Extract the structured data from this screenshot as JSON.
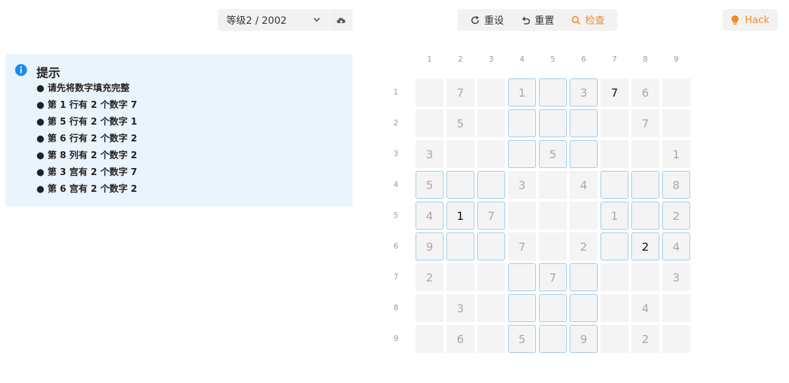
{
  "toolbar": {
    "level_label": "等级2 / 2002",
    "reset_label": "重设",
    "redo_label": "重置",
    "check_label": "检查",
    "hack_label": "Hack"
  },
  "hints": {
    "title": "提示",
    "items": [
      "● 请先将数字填充完整",
      "● 第 1 行有 2 个数字 7",
      "● 第 5 行有 2 个数字 1",
      "● 第 6 行有 2 个数字 2",
      "● 第 8 列有 2 个数字 2",
      "● 第 3 宫有 2 个数字 7",
      "● 第 6 宫有 2 个数字 2"
    ]
  },
  "grid": {
    "col_labels": [
      "1",
      "2",
      "3",
      "4",
      "5",
      "6",
      "7",
      "8",
      "9"
    ],
    "row_labels": [
      "1",
      "2",
      "3",
      "4",
      "5",
      "6",
      "7",
      "8",
      "9"
    ],
    "cells": [
      [
        "",
        "7",
        "",
        "1",
        "",
        "3",
        "7",
        "6",
        ""
      ],
      [
        "",
        "5",
        "",
        "",
        "",
        "",
        "",
        "7",
        ""
      ],
      [
        "3",
        "",
        "",
        "",
        "5",
        "",
        "",
        "",
        "1"
      ],
      [
        "5",
        "",
        "",
        "3",
        "",
        "4",
        "",
        "",
        "8"
      ],
      [
        "4",
        "1",
        "7",
        "",
        "",
        "",
        "1",
        "",
        "2"
      ],
      [
        "9",
        "",
        "",
        "7",
        "",
        "2",
        "",
        "2",
        "4"
      ],
      [
        "2",
        "",
        "",
        "",
        "7",
        "",
        "",
        "",
        "3"
      ],
      [
        "",
        "3",
        "",
        "",
        "",
        "",
        "",
        "4",
        ""
      ],
      [
        "",
        "6",
        "",
        "5",
        "",
        "9",
        "",
        "2",
        ""
      ]
    ],
    "user_entered": [
      [
        0,
        6
      ],
      [
        4,
        1
      ],
      [
        5,
        7
      ]
    ],
    "colors": {
      "given": "#a8a8a8",
      "user": "#111111",
      "highlight_border": "#9ecbe6",
      "cell_bg": "#f4f4f4"
    }
  },
  "colors": {
    "accent": "#f08a24",
    "info": "#1a8cf0",
    "hint_bg": "#eaf4fd"
  },
  "icons": {
    "level_chevron": "chevron-down-icon",
    "cloud": "cloud-download-icon",
    "reset": "refresh-icon",
    "redo": "undo-icon",
    "check": "search-icon",
    "hack": "lightbulb-icon",
    "hint": "info-icon"
  }
}
